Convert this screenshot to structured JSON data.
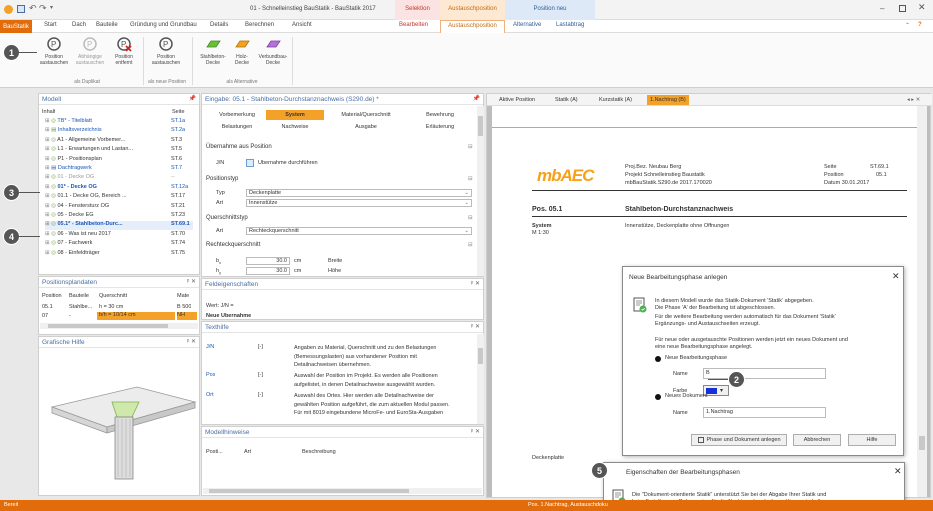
{
  "window": {
    "title": "01 - Schnelleinstieg BauStatik - BauStatik 2017",
    "ctx_selektion": "Selektion",
    "ctx_austausch": "Austauschposition",
    "ctx_positionneu": "Position neu",
    "help": "?"
  },
  "tabs": {
    "file": "BauStatik",
    "items": [
      "Start",
      "Dach",
      "Bauteile",
      "Gründung und Grundbau",
      "Details",
      "Berechnen",
      "Ansicht"
    ],
    "ctx_items": [
      "Bearbeiten",
      "Austauschposition",
      "Alternative",
      "Lastabtrag"
    ]
  },
  "ribbon": {
    "b1": "Position\naustauschen",
    "b2": "Abhängige\naustauschen",
    "b3": "Position\nentfernt",
    "b4": "Position\naustauschen",
    "b5": "Stahlbeton-\nDecke",
    "b6": "Holz-\nDecke",
    "b7": "Verbundbau-\nDecke",
    "grp1": "als Duplikat",
    "grp2": "als neue Position",
    "grp3": "als Alternative"
  },
  "model": {
    "title": "Modell",
    "col_inhalt": "Inhalt",
    "col_seite": "Seite",
    "rows": [
      {
        "label": "TB* - Titelblatt",
        "page": "ST.1a"
      },
      {
        "label": "Inhaltsverzeichnis",
        "page": "ST.2a"
      },
      {
        "label": "A1 - Allgemeine Vorbemer...",
        "page": "ST.3"
      },
      {
        "label": "L1 - Erwartungen und Lastan...",
        "page": "ST.5"
      },
      {
        "label": "P1 - Positionsplan",
        "page": "ST.6"
      },
      {
        "label": "Dachtragwerk",
        "page": "ST.7"
      },
      {
        "label": "01 - Decke OG",
        "page": "--"
      },
      {
        "label": "01* - Decke OG",
        "page": "ST.12a"
      },
      {
        "label": "01.1 - Decke OG, Bereich ...",
        "page": "ST.17"
      },
      {
        "label": "04 - Fenstersturz OG",
        "page": "ST.21"
      },
      {
        "label": "05 - Decke EG",
        "page": "ST.23"
      },
      {
        "label": "05.1* - Stahlbeton-Durc...",
        "page": "ST.69.1"
      },
      {
        "label": "06 - Was ist neu 2017",
        "page": "ST.70"
      },
      {
        "label": "07 - Fachwerk",
        "page": "ST.74"
      },
      {
        "label": "08 - Einfeldträger",
        "page": "ST.75"
      }
    ]
  },
  "posplan": {
    "title": "Positionsplandaten",
    "headers": [
      "Position",
      "Bauteile",
      "Querschnitt",
      "Mate"
    ],
    "rows": [
      [
        "05.1",
        "Stahlbe...",
        "h = 30 cm",
        "B 500"
      ],
      [
        "07",
        "-",
        "b/h = 10/14 cm",
        "NH"
      ]
    ]
  },
  "hilfe": {
    "title": "Grafische Hilfe"
  },
  "input": {
    "title": "Eingabe: 05.1 - Stahlbeton-Durchstanznachweis (S290.de) *",
    "tabs_row1": [
      "Vorbemerkung",
      "System",
      "Material/Querschnitt",
      "Bewehrung"
    ],
    "tabs_row2": [
      "Belastungen",
      "Nachweise",
      "Ausgabe",
      "Erläuterung"
    ],
    "sec1": "Übernahme aus Position",
    "jn": "J/N",
    "cb_label": "Übernahme durchführen",
    "sec2": "Positionstyp",
    "typ_label": "Typ",
    "typ_value": "Deckenplatte",
    "art_label": "Art",
    "art_value": "Innenstütze",
    "sec3": "Querschnittstyp",
    "art2_label": "Art",
    "art2_value": "Rechteckquerschnitt",
    "sec4": "Rechteckquerschnitt",
    "bx": "b",
    "bx_val": "30.0",
    "bx_unit": "cm",
    "bx_desc": "Breite",
    "hy": "h",
    "hy_val": "30.0",
    "hy_unit": "cm",
    "hy_desc": "Höhe"
  },
  "feld": {
    "title": "Feldeigenschaften",
    "wert": "Wert: J/N =",
    "neu": "Neue Übernahme"
  },
  "texthilfe": {
    "title": "Texthilfe",
    "rows": [
      {
        "k": "J/N",
        "u": "[-]",
        "t": "Angaben zu Material, Querschnitt und zu den Belastungen\n(Bemessungslasten) aus vorhandener Position mit\nDetailnachweisen übernehmen."
      },
      {
        "k": "Pos",
        "u": "[-]",
        "t": "Auswahl der Position im Projekt. Es werden alle Positionen\naufgelistet, in denen Detailnachweise ausgewählt wurden."
      },
      {
        "k": "Ort",
        "u": "[-]",
        "t": "Auswahl des Ortes. Hier werden alle Detailnachweise der\ngewählten Position aufgeführt, die zum aktuellen Modul passen.\nFür mit 8019 eingebundene MicroFe- und EuroSta-Ausgaben"
      }
    ]
  },
  "hinweise": {
    "title": "Modellhinweise",
    "headers": [
      "Posti...",
      "Art",
      "Beschreibung"
    ]
  },
  "doc": {
    "tabs": [
      "Aktive Position",
      "Statik (A)",
      "Kurzstatik (A)",
      "1.Nachtrag (B)"
    ],
    "logo": "mbAEC",
    "proj": "Proj.Bez. Neubau Berg",
    "projekt": "Projekt Schnelleinstieg Baustatik",
    "file": "mbBauStatik.S290.de 2017.170020",
    "seite": "Seite",
    "seite_val": "ST.69.1",
    "position": "Position",
    "position_val": "05.1",
    "datum": "Datum 30.01.2017",
    "pos": "Pos. 05.1",
    "heading": "Stahlbeton-Durchstanznachweis",
    "system": "System",
    "scale": "M 1:30",
    "desc": "Innenstütze, Deckenplatte ohne Öffnungen",
    "decke": "Deckenplatte"
  },
  "dialog1": {
    "title": "Neue Bearbeitungsphase anlegen",
    "info1": "In diesem Modell wurde das Statik-Dokument 'Statik' abgegeben.\nDie Phase 'A' der Bearbeitung ist abgeschlossen.",
    "info2": "Für die weitere Bearbeitung werden automatisch für das Dokument 'Statik'\nErgänzungs- und Austauschseiten erzeugt.",
    "info3": "Für neue oder ausgetauschte Positionen werden jetzt ein neues Dokument und\neine neue Bearbeitungsphase angelegt.",
    "radio1": "Neue Bearbeitungsphase",
    "name_label": "Name",
    "name_value": "B",
    "farbe_label": "Farbe",
    "radio2": "Neues Dokument",
    "name2_label": "Name",
    "name2_value": "1.Nachtrag",
    "btn_create": "Phase und Dokument anlegen",
    "btn_cancel": "Abbrechen",
    "btn_help": "Hilfe",
    "color": "#1530d8"
  },
  "dialog2": {
    "title": "Eigenschaften der Bearbeitungsphasen",
    "text": "Die \"Dokument-orientierte Statik\" unterstützt Sie bei der Abgabe Ihrer Statik und\nbeim Erstellen von Dokumenten für die Nachtragsbearbeitung. Hierzu sind alle"
  },
  "status": {
    "left": "Bereit",
    "right": "Pos. 1.Nachtrag, Austauschdoku"
  },
  "callouts": [
    "1",
    "2",
    "3",
    "4",
    "5"
  ],
  "colors": {
    "accent": "#e36c0a",
    "selection": "#f4a12a",
    "link": "#1a57b4"
  }
}
